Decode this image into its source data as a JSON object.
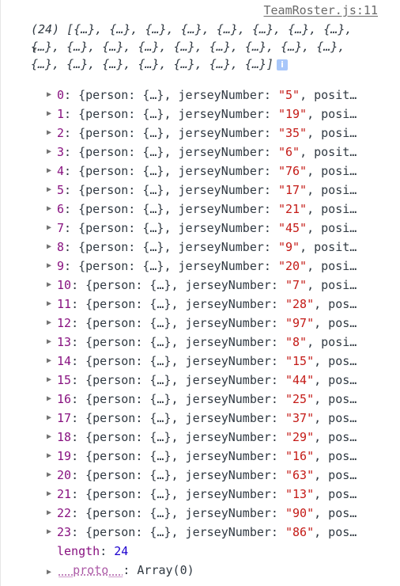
{
  "console": {
    "source_link": "TeamRoster.js:11",
    "summary_text": "(24) [{…}, {…}, {…}, {…}, {…}, {…}, {…}, {…}, {…}, {…}, {…}, {…}, {…}, {…}, {…}, {…}, {…}, {…}, {…}, {…}, {…}, {…}, {…}, {…}]",
    "info_badge": "i",
    "entries": [
      {
        "index": "0",
        "jersey": "5",
        "tail": ", posit…"
      },
      {
        "index": "1",
        "jersey": "19",
        "tail": ", posi…"
      },
      {
        "index": "2",
        "jersey": "35",
        "tail": ", posi…"
      },
      {
        "index": "3",
        "jersey": "6",
        "tail": ", posit…"
      },
      {
        "index": "4",
        "jersey": "76",
        "tail": ", posi…"
      },
      {
        "index": "5",
        "jersey": "17",
        "tail": ", posi…"
      },
      {
        "index": "6",
        "jersey": "21",
        "tail": ", posi…"
      },
      {
        "index": "7",
        "jersey": "45",
        "tail": ", posi…"
      },
      {
        "index": "8",
        "jersey": "9",
        "tail": ", posit…"
      },
      {
        "index": "9",
        "jersey": "20",
        "tail": ", posi…"
      },
      {
        "index": "10",
        "jersey": "7",
        "tail": ", posi…"
      },
      {
        "index": "11",
        "jersey": "28",
        "tail": ", pos…"
      },
      {
        "index": "12",
        "jersey": "97",
        "tail": ", pos…"
      },
      {
        "index": "13",
        "jersey": "8",
        "tail": ", posi…"
      },
      {
        "index": "14",
        "jersey": "15",
        "tail": ", pos…"
      },
      {
        "index": "15",
        "jersey": "44",
        "tail": ", pos…"
      },
      {
        "index": "16",
        "jersey": "25",
        "tail": ", pos…"
      },
      {
        "index": "17",
        "jersey": "37",
        "tail": ", pos…"
      },
      {
        "index": "18",
        "jersey": "29",
        "tail": ", pos…"
      },
      {
        "index": "19",
        "jersey": "16",
        "tail": ", pos…"
      },
      {
        "index": "20",
        "jersey": "63",
        "tail": ", pos…"
      },
      {
        "index": "21",
        "jersey": "13",
        "tail": ", pos…"
      },
      {
        "index": "22",
        "jersey": "90",
        "tail": ", pos…"
      },
      {
        "index": "23",
        "jersey": "86",
        "tail": ", pos…"
      }
    ],
    "entry_middle": ": {person: {…}, jerseyNumber: ",
    "length_label": "length",
    "length_value": "24",
    "proto_label": "__proto__",
    "proto_value": "Array(0)"
  }
}
